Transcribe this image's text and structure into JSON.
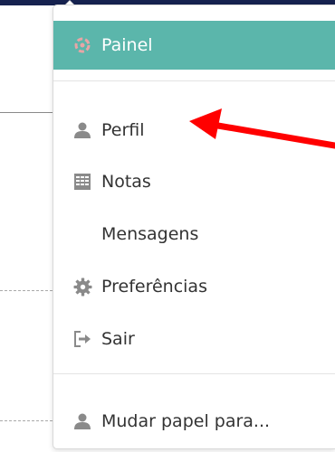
{
  "menu": {
    "items": [
      {
        "label": "Painel",
        "icon": "dashboard-icon",
        "active": true
      },
      {
        "label": "Perfil",
        "icon": "user-icon"
      },
      {
        "label": "Notas",
        "icon": "grades-table-icon"
      },
      {
        "label": "Mensagens",
        "icon": ""
      },
      {
        "label": "Preferências",
        "icon": "gear-icon"
      },
      {
        "label": "Sair",
        "icon": "logout-icon"
      },
      {
        "label": "Mudar papel para...",
        "icon": "user-icon"
      }
    ]
  },
  "colors": {
    "active_bg": "#5bb6ab",
    "icon_gray": "#8a8a8a",
    "arrow": "#ff0000",
    "top_bar": "#16224f"
  }
}
